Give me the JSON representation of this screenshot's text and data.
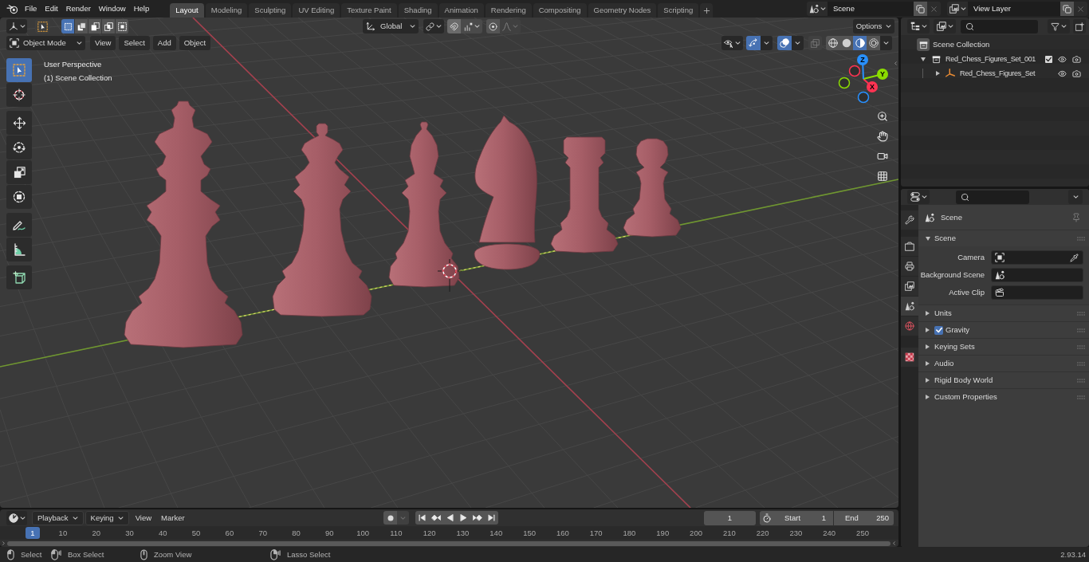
{
  "top_bar": {
    "menus": [
      "File",
      "Edit",
      "Render",
      "Window",
      "Help"
    ],
    "workspaces": [
      {
        "label": "Layout",
        "selected": true
      },
      {
        "label": "Modeling",
        "selected": false
      },
      {
        "label": "Sculpting",
        "selected": false
      },
      {
        "label": "UV Editing",
        "selected": false
      },
      {
        "label": "Texture Paint",
        "selected": false
      },
      {
        "label": "Shading",
        "selected": false
      },
      {
        "label": "Animation",
        "selected": false
      },
      {
        "label": "Rendering",
        "selected": false
      },
      {
        "label": "Compositing",
        "selected": false
      },
      {
        "label": "Geometry Nodes",
        "selected": false
      },
      {
        "label": "Scripting",
        "selected": false
      }
    ],
    "scene": "Scene",
    "view_layer": "View Layer"
  },
  "viewport": {
    "header": {
      "selection_modes": [
        {
          "selected": true
        },
        {
          "selected": false
        },
        {
          "selected": false
        },
        {
          "selected": false
        },
        {
          "selected": false
        }
      ],
      "orientation": "Global",
      "snap_on": true,
      "proportional_on": false,
      "options": "Options",
      "mode": "Object Mode",
      "menus": [
        "View",
        "Select",
        "Add",
        "Object"
      ],
      "gizmos_on": true,
      "overlays_on": true,
      "xray_on": false,
      "shading_modes": [
        {
          "selected": false
        },
        {
          "selected": false
        },
        {
          "selected": true
        },
        {
          "selected": false
        }
      ]
    },
    "tool_groups": [
      {
        "tools": [
          {
            "selected": true
          },
          {
            "selected": false
          }
        ]
      },
      {
        "tools": [
          {
            "selected": false
          },
          {
            "selected": false
          },
          {
            "selected": false
          },
          {
            "selected": false
          }
        ]
      },
      {
        "tools": [
          {
            "selected": false
          },
          {
            "selected": false
          }
        ]
      },
      {
        "tools": [
          {
            "selected": false
          }
        ]
      }
    ],
    "info": [
      "User Perspective",
      "(1) Scene Collection"
    ],
    "gizmo_axes": [
      {
        "label": "X",
        "color": "#ff3352"
      },
      {
        "label": "Y",
        "color": "#8bdc00"
      },
      {
        "label": "Z",
        "color": "#2890ff"
      }
    ]
  },
  "outliner": {
    "root": "Scene Collection",
    "items": [
      {
        "name": "Red_Chess_Figures_Set_001",
        "kind": "collection",
        "expanded": true,
        "checked": true,
        "children": [
          {
            "name": "Red_Chess_Figures_Set",
            "kind": "empty",
            "expanded": false
          }
        ]
      }
    ]
  },
  "properties": {
    "tabs": [
      {
        "selected": false
      },
      {
        "selected": false
      },
      {
        "selected": false
      },
      {
        "selected": false
      },
      {
        "selected": true
      },
      {
        "selected": false
      },
      {
        "selected": false
      }
    ],
    "context": "Scene",
    "panels": [
      {
        "title": "Scene",
        "expanded": true,
        "fields": [
          {
            "label": "Camera",
            "kind": "object"
          },
          {
            "label": "Background Scene",
            "kind": "scene"
          },
          {
            "label": "Active Clip",
            "kind": "clip"
          }
        ]
      },
      {
        "title": "Units",
        "expanded": false
      },
      {
        "title": "Gravity",
        "expanded": false,
        "checked": true
      },
      {
        "title": "Keying Sets",
        "expanded": false
      },
      {
        "title": "Audio",
        "expanded": false
      },
      {
        "title": "Rigid Body World",
        "expanded": false
      },
      {
        "title": "Custom Properties",
        "expanded": false
      }
    ]
  },
  "timeline": {
    "menus": [
      {
        "label": "Playback",
        "kind": "dropdown"
      },
      {
        "label": "Keying",
        "kind": "dropdown"
      },
      {
        "label": "View",
        "kind": "menu"
      },
      {
        "label": "Marker",
        "kind": "menu"
      }
    ],
    "current_frame": "1",
    "start": {
      "label": "Start",
      "value": "1"
    },
    "end": {
      "label": "End",
      "value": "250"
    },
    "playhead": "1",
    "ticks": [
      "10",
      "20",
      "30",
      "40",
      "50",
      "60",
      "70",
      "80",
      "90",
      "100",
      "110",
      "120",
      "130",
      "140",
      "150",
      "160",
      "170",
      "180",
      "190",
      "200",
      "210",
      "220",
      "230",
      "240",
      "250"
    ]
  },
  "status_bar": {
    "hints": [
      {
        "label": "Select",
        "kind": "left_click"
      },
      {
        "label": "Box Select",
        "kind": "left_drag"
      },
      {
        "label": "Zoom View",
        "kind": "middle_click"
      },
      {
        "label": "Lasso Select",
        "kind": "right_drag"
      }
    ],
    "version": "2.93.14"
  }
}
